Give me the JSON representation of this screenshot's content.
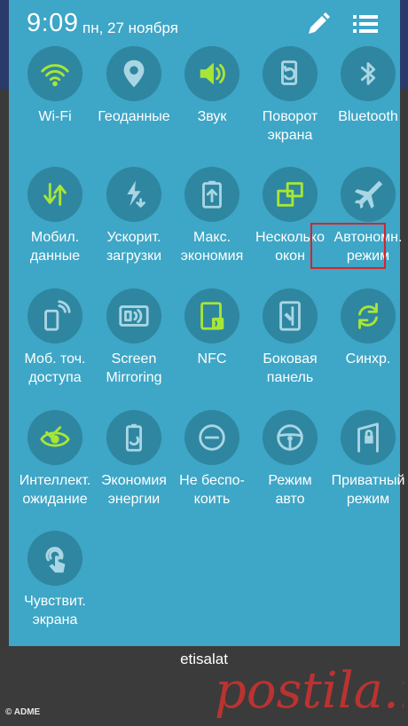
{
  "status_bar": {
    "time": "9:09",
    "date": "пн, 27 ноября"
  },
  "colors": {
    "panel": "#3ea6c6",
    "circle": "#2f86a0",
    "active_icon": "#a8e636",
    "inactive_icon": "#a9d6e4",
    "highlight_border": "#d8232a"
  },
  "tiles": [
    {
      "label": "Wi-Fi",
      "icon": "wifi-icon",
      "active": true
    },
    {
      "label": "Геоданные",
      "icon": "location-pin-icon",
      "active": false
    },
    {
      "label": "Звук",
      "icon": "speaker-icon",
      "active": true
    },
    {
      "label": "Поворот\nэкрана",
      "icon": "rotate-screen-icon",
      "active": false
    },
    {
      "label": "Bluetooth",
      "icon": "bluetooth-icon",
      "active": false
    },
    {
      "label": "Мобил.\nданные",
      "icon": "mobile-data-icon",
      "active": true
    },
    {
      "label": "Ускорит.\nзагрузки",
      "icon": "download-booster-icon",
      "active": false
    },
    {
      "label": "Макс.\nэкономия",
      "icon": "ultra-power-saving-icon",
      "active": false
    },
    {
      "label": "Несколько\nокон",
      "icon": "multi-window-icon",
      "active": true
    },
    {
      "label": "Автономн.\nрежим",
      "icon": "airplane-icon",
      "active": false
    },
    {
      "label": "Моб. точ.\nдоступа",
      "icon": "hotspot-icon",
      "active": false
    },
    {
      "label": "Screen\nMirroring",
      "icon": "screen-mirroring-icon",
      "active": false
    },
    {
      "label": "NFC",
      "icon": "nfc-icon",
      "active": true
    },
    {
      "label": "Боковая\nпанель",
      "icon": "edge-panel-icon",
      "active": false
    },
    {
      "label": "Синхр.",
      "icon": "sync-icon",
      "active": true
    },
    {
      "label": "Интеллект.\nожидание",
      "icon": "smart-stay-icon",
      "active": true
    },
    {
      "label": "Экономия\nэнергии",
      "icon": "power-saving-icon",
      "active": false
    },
    {
      "label": "Не беспо-\nкоить",
      "icon": "do-not-disturb-icon",
      "active": false
    },
    {
      "label": "Режим\nавто",
      "icon": "car-mode-icon",
      "active": false
    },
    {
      "label": "Приватный\nрежим",
      "icon": "private-mode-icon",
      "active": false
    },
    {
      "label": "Чувствит.\nэкрана",
      "icon": "touch-sensitivity-icon",
      "active": false
    }
  ],
  "carrier": "etisalat",
  "credit": "© ADME",
  "watermark": "postila.ru"
}
